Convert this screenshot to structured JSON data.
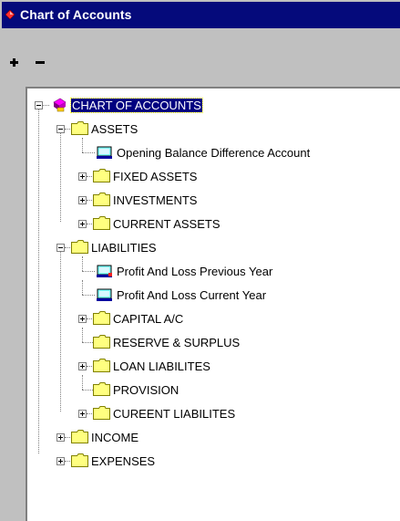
{
  "window": {
    "title": "Chart of Accounts"
  },
  "toolbar": {
    "add_symbol": "+",
    "remove_symbol": "−"
  },
  "colors": {
    "titlebar": "#050a7b",
    "selection": "#000080",
    "folder": "#ffff80"
  },
  "icons": {
    "title": "diamond-icon",
    "root": "books-icon",
    "folder": "folder-icon",
    "account": "account-icon"
  },
  "tree": {
    "root": "CHART OF ACCOUNTS",
    "assets": {
      "label": "ASSETS",
      "children": [
        "Opening Balance Difference Account",
        "FIXED ASSETS",
        "INVESTMENTS",
        "CURRENT ASSETS"
      ]
    },
    "liabilities": {
      "label": "LIABILITIES",
      "children": [
        "Profit And Loss Previous Year",
        "Profit And Loss Current Year",
        "CAPITAL A/C",
        "RESERVE & SURPLUS",
        "LOAN LIABILITES",
        "PROVISION",
        "CUREENT LIABILITES"
      ]
    },
    "income": "INCOME",
    "expenses": "EXPENSES"
  }
}
